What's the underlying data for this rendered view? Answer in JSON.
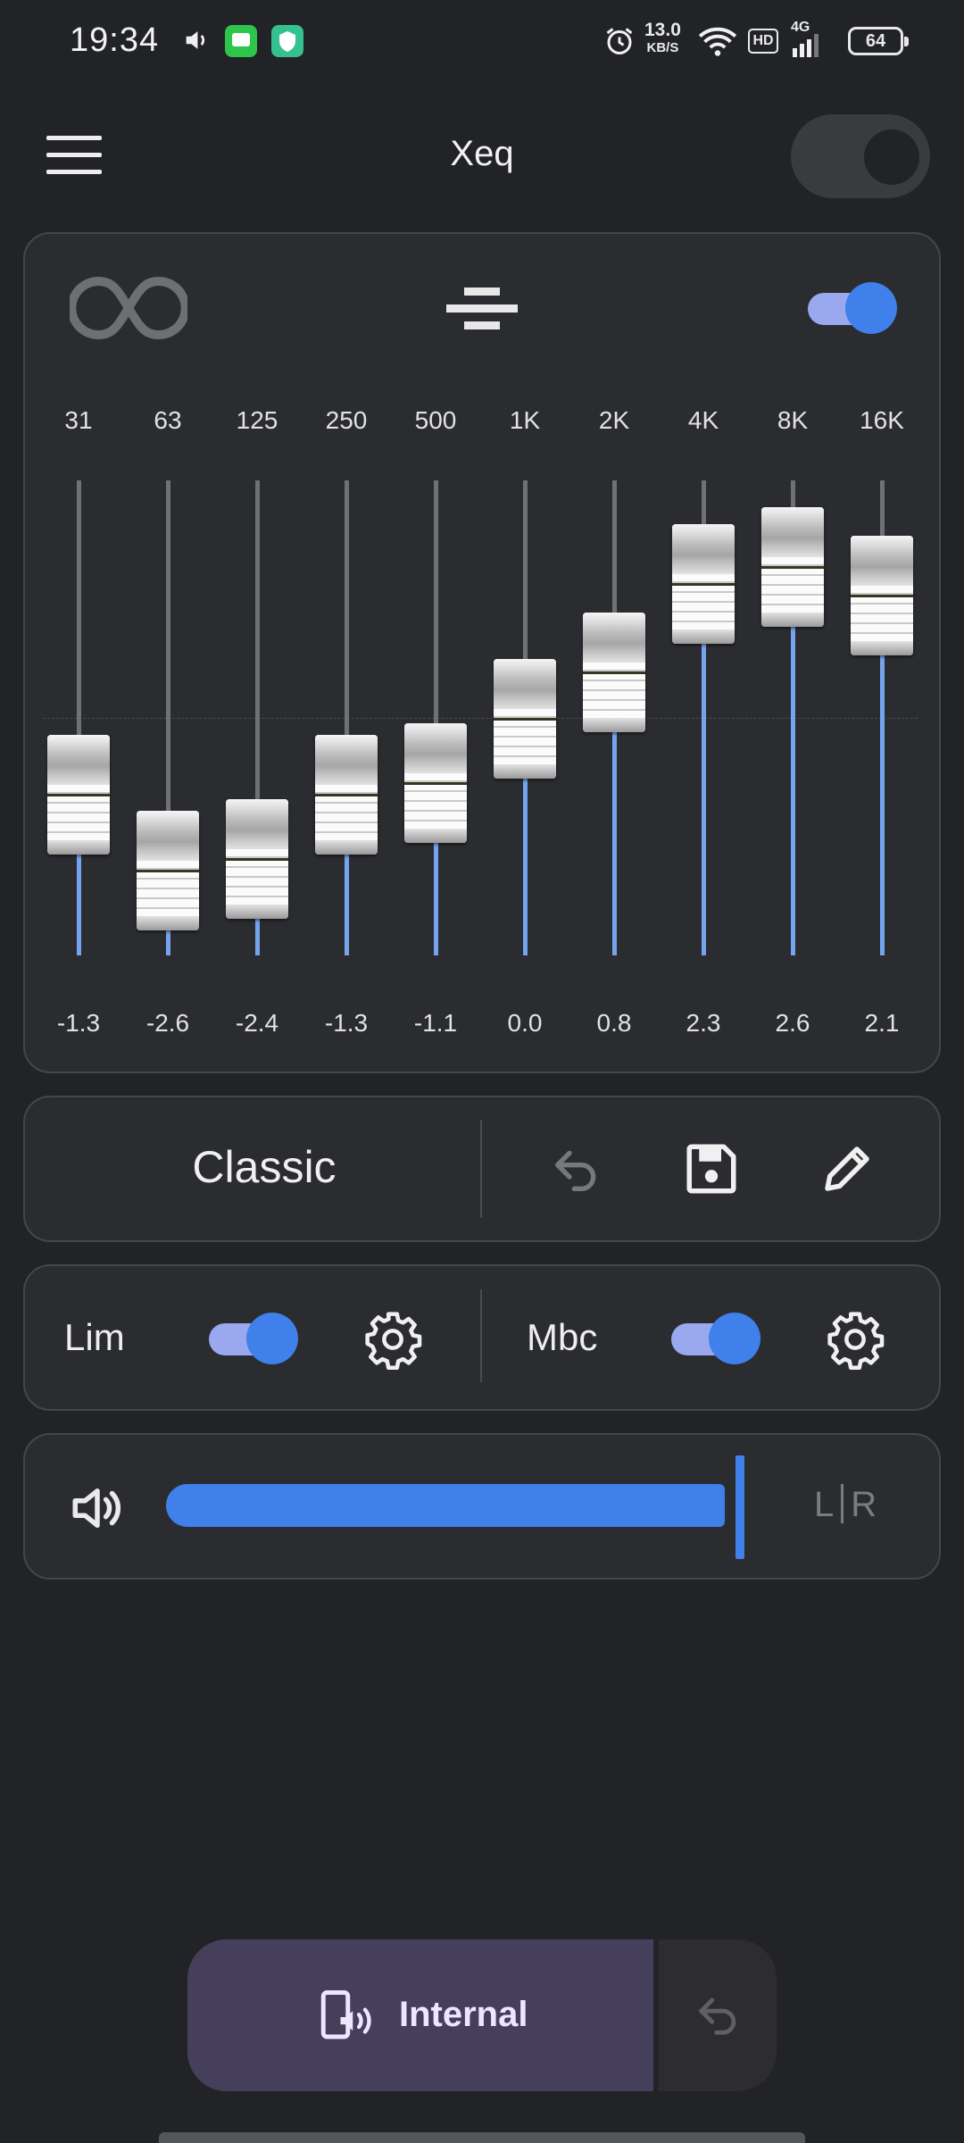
{
  "status_bar": {
    "time": "19:34",
    "net_speed_value": "13.0",
    "net_speed_unit": "KB/S",
    "hd_badge": "HD",
    "network_type": "4G",
    "battery_level": "64",
    "icons": [
      "volume-icon",
      "messages-app-icon",
      "security-app-icon",
      "alarm-icon",
      "wifi-icon",
      "signal-icon",
      "battery-icon"
    ]
  },
  "header": {
    "title": "Xeq",
    "menu_icon": "hamburger-menu-icon",
    "power_toggle_on": false
  },
  "equalizer": {
    "enabled": true,
    "bands": [
      {
        "freq": "31",
        "gain": "-1.3"
      },
      {
        "freq": "63",
        "gain": "-2.6"
      },
      {
        "freq": "125",
        "gain": "-2.4"
      },
      {
        "freq": "250",
        "gain": "-1.3"
      },
      {
        "freq": "500",
        "gain": "-1.1"
      },
      {
        "freq": "1K",
        "gain": "0.0"
      },
      {
        "freq": "2K",
        "gain": "0.8"
      },
      {
        "freq": "4K",
        "gain": "2.3"
      },
      {
        "freq": "8K",
        "gain": "2.6"
      },
      {
        "freq": "16K",
        "gain": "2.1"
      }
    ]
  },
  "preset": {
    "name": "Classic",
    "actions": [
      "undo-icon",
      "save-icon",
      "edit-icon"
    ]
  },
  "effects": {
    "limiter": {
      "label": "Lim",
      "enabled": true
    },
    "mbc": {
      "label": "Mbc",
      "enabled": true
    }
  },
  "balance": {
    "left_label": "L",
    "right_label": "R",
    "level": 0.83
  },
  "output": {
    "label": "Internal"
  },
  "colors": {
    "accent": "#3f80ea",
    "background": "#222327",
    "card": "#2b2c30",
    "output_button": "#463f5c"
  }
}
